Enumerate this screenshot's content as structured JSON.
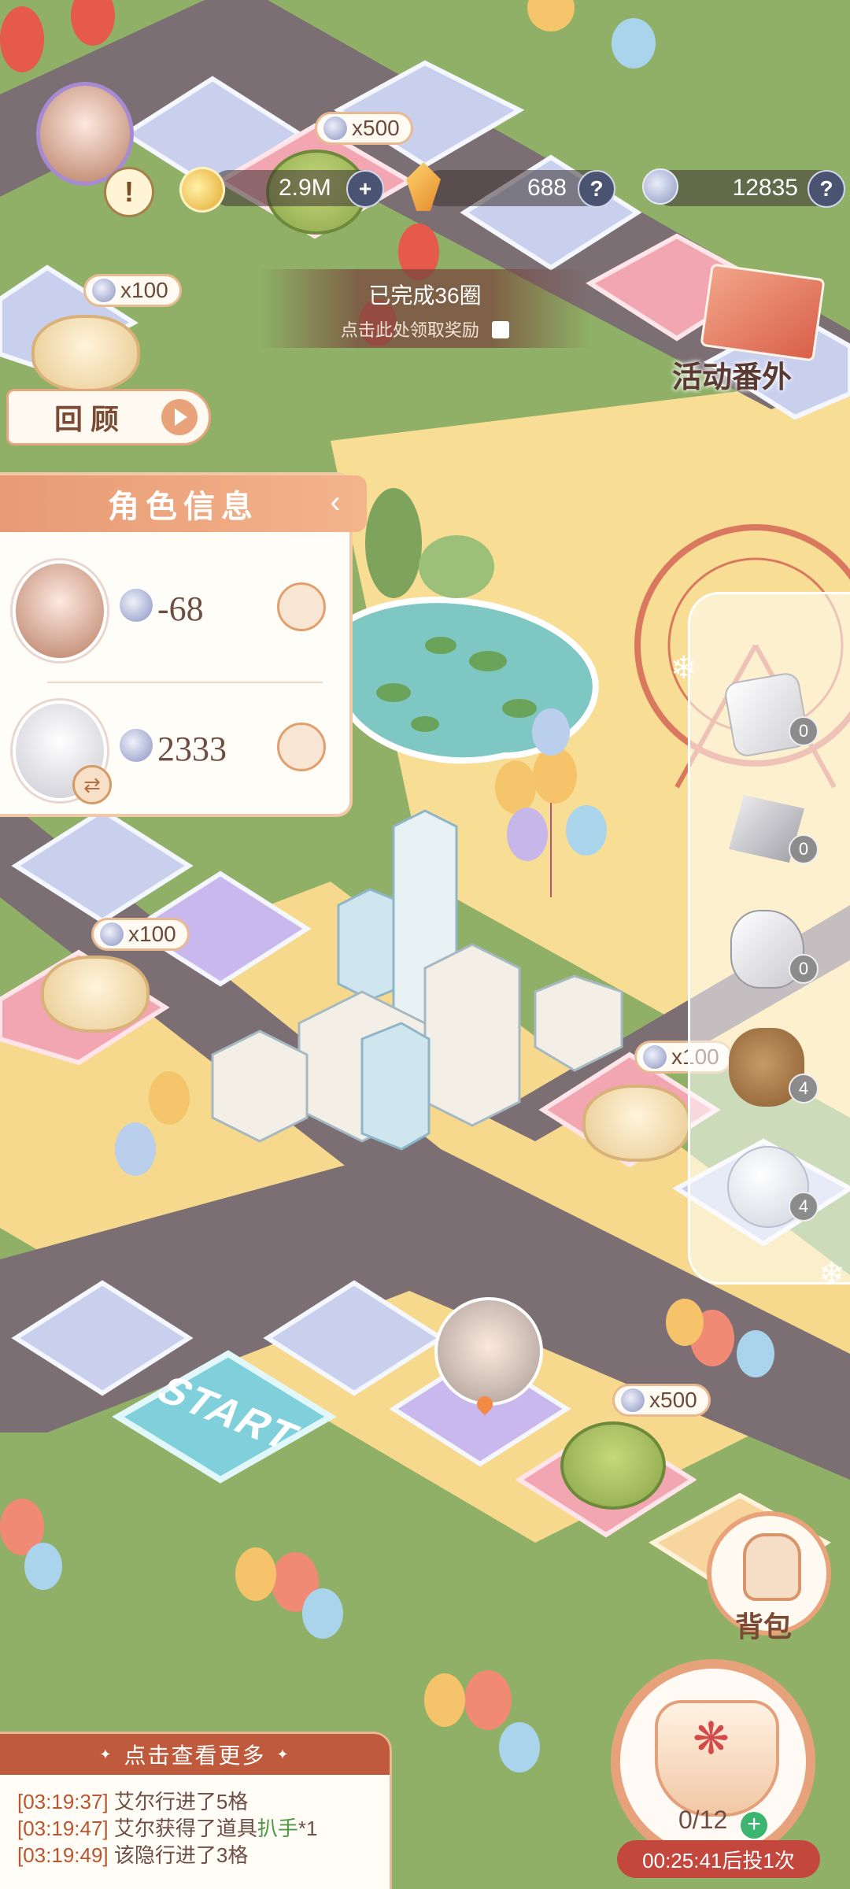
{
  "colors": {
    "grass": "#8fb066",
    "road": "#7c6f74",
    "path": "#f8dd95",
    "accent": "#e7a27c",
    "timer": "#c4473e"
  },
  "top_bar": {
    "gold": "2.9M",
    "crystal": "688",
    "silver": "12835",
    "plus_icon": "+",
    "help_icon": "?"
  },
  "board_rewards": [
    {
      "id": "matcha-cake-top",
      "label": "x500"
    },
    {
      "id": "mooncake-left",
      "label": "x100"
    },
    {
      "id": "mooncake-mid",
      "label": "x100"
    },
    {
      "id": "mooncake-right",
      "label": "x100"
    },
    {
      "id": "matcha-cake-bottom",
      "label": "x500"
    }
  ],
  "circle_banner": {
    "line1": "已完成36圈",
    "line2": "点击此处领取奖励"
  },
  "event_banner": {
    "label": "活动番外"
  },
  "start_tile": {
    "label": "START"
  },
  "review_button": {
    "label": "回顾"
  },
  "character_info": {
    "title": "角色信息",
    "rows": [
      {
        "value": "-68"
      },
      {
        "value": "2333"
      }
    ]
  },
  "items": [
    {
      "icon": "dice-icon",
      "count": "0"
    },
    {
      "icon": "rocket-icon",
      "count": "0"
    },
    {
      "icon": "glove-icon",
      "count": "0"
    },
    {
      "icon": "money-bag-icon",
      "count": "4"
    },
    {
      "icon": "snowball-icon",
      "count": "4"
    }
  ],
  "bag_button": {
    "label": "背包"
  },
  "dice_button": {
    "counter": "0/12",
    "timer": "00:25:41后投1次"
  },
  "log": {
    "header": "点击查看更多",
    "lines": [
      {
        "time": "[03:19:37]",
        "text": "艾尔行进了5格",
        "item": "",
        "suffix": ""
      },
      {
        "time": "[03:19:47]",
        "text": "艾尔获得了道具",
        "item": "扒手",
        "suffix": "*1"
      },
      {
        "time": "[03:19:49]",
        "text": "该隐行进了3格",
        "item": "",
        "suffix": ""
      }
    ]
  }
}
